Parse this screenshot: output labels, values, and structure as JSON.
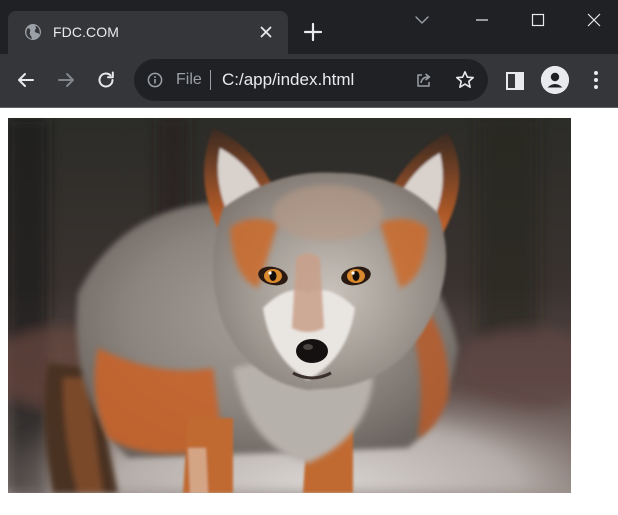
{
  "window": {
    "tab": {
      "title": "FDC.COM",
      "favicon": "globe-icon",
      "close_icon": "close-icon"
    },
    "new_tab_icon": "plus-icon",
    "tab_search_icon": "chevron-down-icon",
    "controls": [
      "minimize-icon",
      "maximize-icon",
      "close-icon"
    ]
  },
  "toolbar": {
    "back_icon": "arrow-left-icon",
    "forward_icon": "arrow-right-icon",
    "reload_icon": "reload-icon",
    "omnibox": {
      "security_icon": "info-icon",
      "scheme_label": "File",
      "url": "C:/app/index.html",
      "share_icon": "share-icon",
      "bookmark_icon": "star-icon"
    },
    "side_panel_icon": "side-panel-icon",
    "profile_icon": "person-icon",
    "menu_icon": "kebab-menu-icon"
  },
  "page": {
    "image": {
      "subject": "fox",
      "colors": {
        "fur_orange": "#c8642a",
        "fur_gray": "#9c9894",
        "background_dark": "#2b2b27",
        "ground_light": "#cfcac6"
      }
    }
  },
  "theme": {
    "titlebar_bg": "#202124",
    "toolbar_bg": "#35363a",
    "omnibox_bg": "#202124",
    "text_primary": "#e8eaed",
    "text_secondary": "#9aa0a6"
  }
}
